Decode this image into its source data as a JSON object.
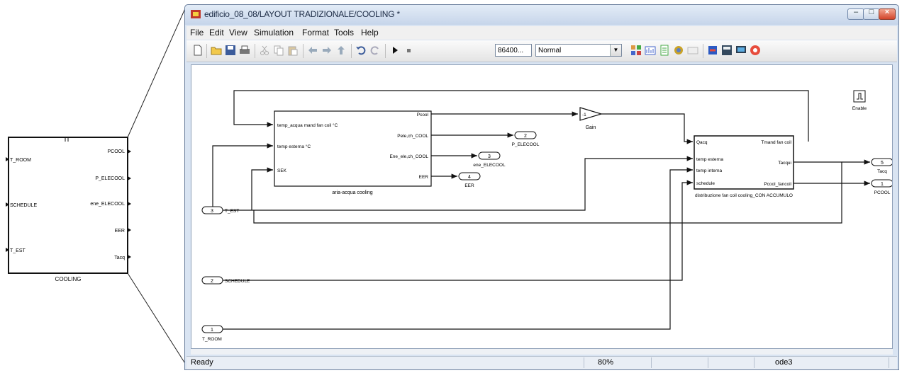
{
  "subsystem_block": {
    "name": "COOLING",
    "inputs": [
      "T_ROOM",
      "SCHEDULE",
      "T_EST"
    ],
    "outputs": [
      "PCOOL",
      "P_ELECOOL",
      "ene_ELECOOL",
      "EER",
      "Tacq"
    ]
  },
  "window": {
    "title": "edificio_08_08/LAYOUT TRADIZIONALE/COOLING *"
  },
  "menu": [
    "File",
    "Edit",
    "View",
    "Simulation",
    "Format",
    "Tools",
    "Help"
  ],
  "toolbar": {
    "stop_time": "86400...",
    "sim_mode": "Normal",
    "icons": [
      "new-icon",
      "open-icon",
      "save-icon",
      "print-icon",
      "cut-icon",
      "copy-icon",
      "paste-icon",
      "back-icon",
      "forward-icon",
      "up-icon",
      "undo-icon",
      "redo-icon",
      "play-icon",
      "stop-icon",
      "library-icon",
      "model-explorer-icon",
      "report-icon",
      "debug-icon",
      "scope-icon",
      "build-icon",
      "signals-icon",
      "monitor-icon",
      "record-icon"
    ]
  },
  "diagram": {
    "block1": {
      "title": "aria-acqua cooling",
      "in1": "temp_acqua mand fan coil °C",
      "in2": "temp esterna °C",
      "in3": "SEK",
      "out1": "Pcool",
      "out2": "Pele,ch_COOL",
      "out3": "Ene_ele,ch_COOL",
      "out4": "EER"
    },
    "block2": {
      "title": "distribuzione fan coil cooling_CON ACCUMULO",
      "in1": "Qacq",
      "in2": "temp esterna",
      "in3": "temp interna",
      "in4": "schedule",
      "out1": "Tmand fan coil",
      "out2": "Tacqui",
      "out3": "Pcool_fancoil"
    },
    "gain": {
      "label": "Gain",
      "value": "-1"
    },
    "enable": {
      "label": "Enable"
    },
    "outports": [
      {
        "num": "2",
        "name": "P_ELECOOL"
      },
      {
        "num": "3",
        "name": "ene_ELECOOL"
      },
      {
        "num": "4",
        "name": "EER"
      },
      {
        "num": "5",
        "name": "Tacq"
      },
      {
        "num": "1",
        "name": "PCOOL"
      }
    ],
    "inports": [
      {
        "num": "3",
        "name": "T_EST"
      },
      {
        "num": "2",
        "name": "SCHEDULE"
      },
      {
        "num": "1",
        "name": "T_ROOM"
      }
    ]
  },
  "status": {
    "ready": "Ready",
    "zoom": "80%",
    "solver": "ode3"
  }
}
